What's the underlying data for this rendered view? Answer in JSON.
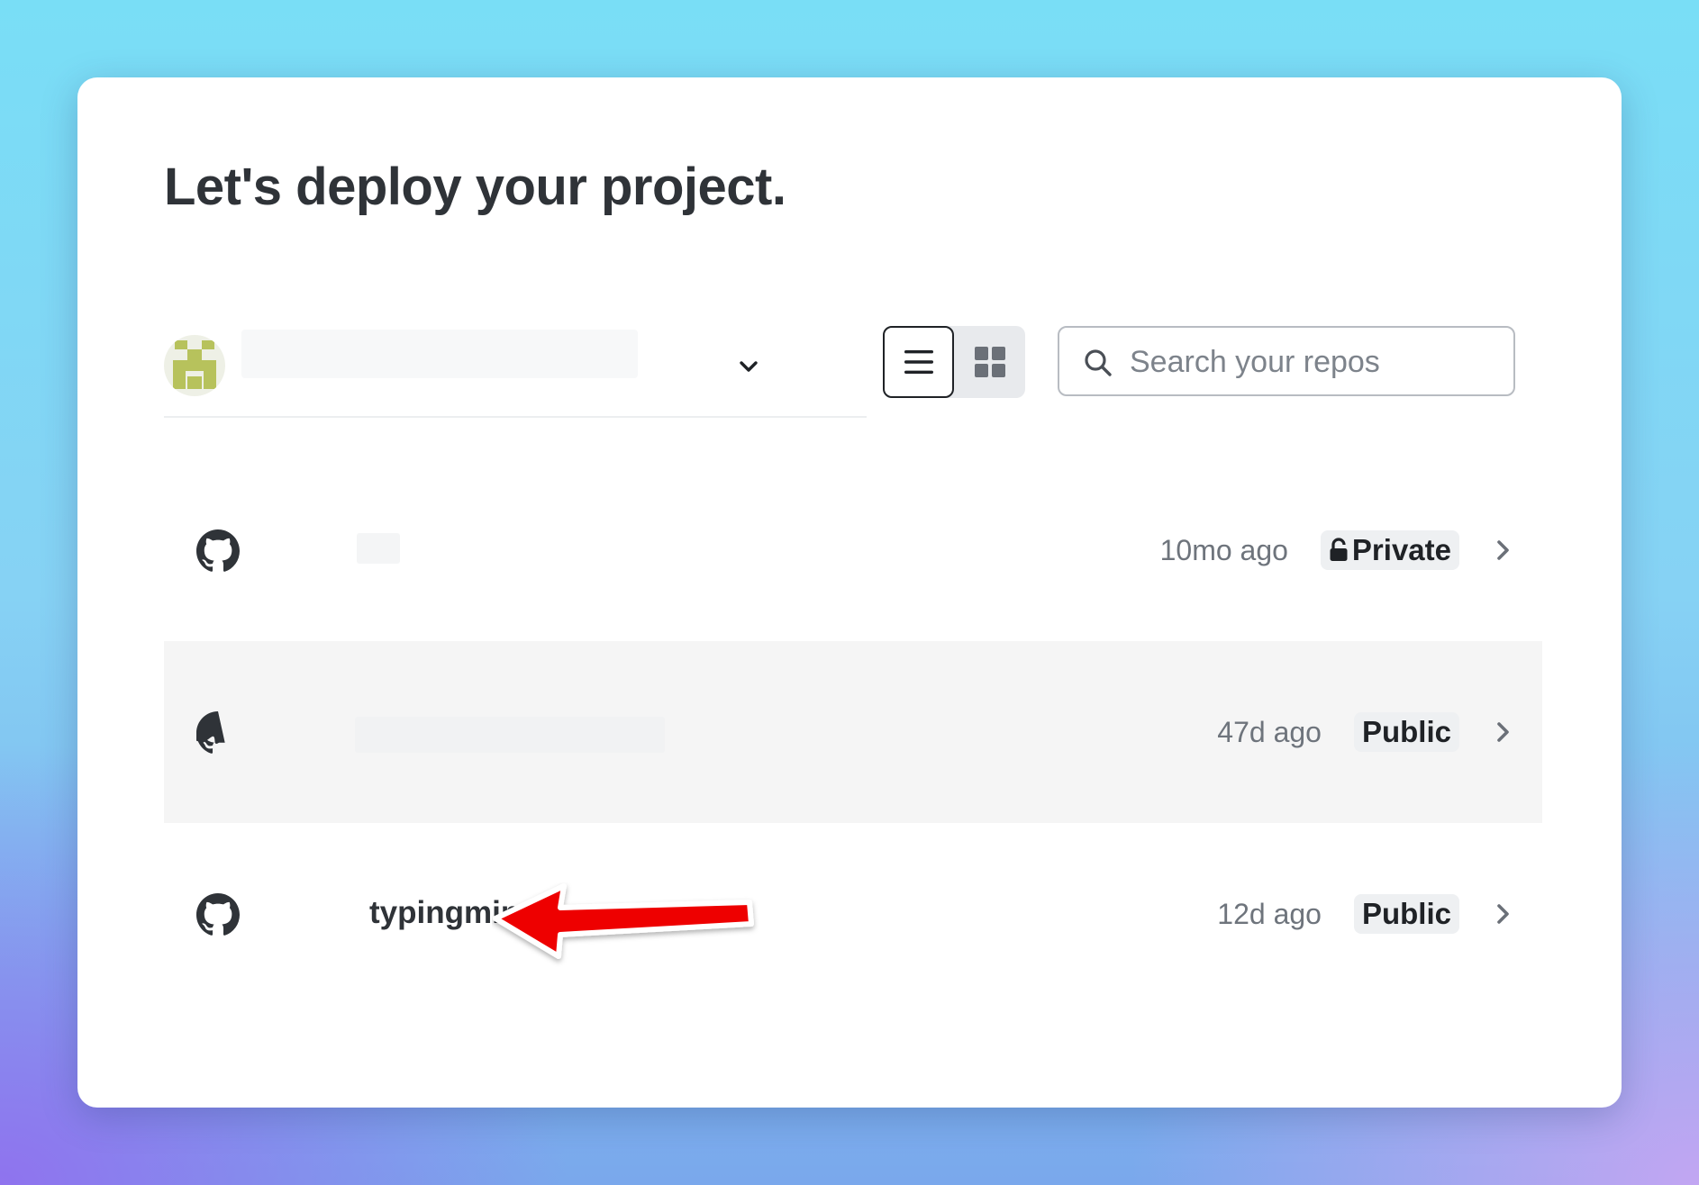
{
  "page": {
    "title": "Let's deploy your project."
  },
  "account": {
    "name": ""
  },
  "view_toggle": {
    "active": "list"
  },
  "search": {
    "placeholder": "Search your repos",
    "value": ""
  },
  "repos": [
    {
      "name": "",
      "updated": "10mo ago",
      "visibility": "Private",
      "locked": true
    },
    {
      "name": "",
      "updated": "47d ago",
      "visibility": "Public",
      "locked": false
    },
    {
      "name": "typingmind",
      "updated": "12d ago",
      "visibility": "Public",
      "locked": false
    }
  ],
  "colors": {
    "accent_arrow": "#ee0000",
    "title_text": "#2f3338",
    "muted_text": "#6e747c",
    "badge_bg": "#eef0f2",
    "row_hover_bg": "#f5f5f5"
  },
  "icons": {
    "repo": "github-icon",
    "lock": "lock-icon",
    "chevron": "chevron-right-icon",
    "search": "search-icon"
  }
}
